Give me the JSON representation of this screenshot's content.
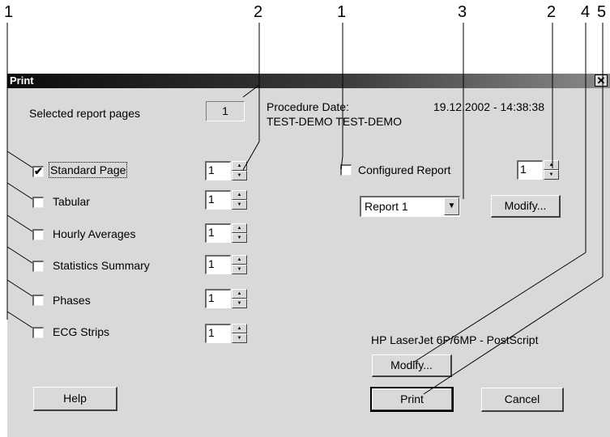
{
  "callouts": [
    "1",
    "2",
    "1",
    "3",
    "2",
    "4",
    "5"
  ],
  "dialog": {
    "title": "Print",
    "close_glyph": "✕",
    "selected_pages_label": "Selected report pages",
    "selected_pages_value": "1",
    "procedure_date_label": "Procedure Date:",
    "procedure_date_value": "19.12.2002 - 14:38:38",
    "patient_name": "TEST-DEMO TEST-DEMO"
  },
  "reports": [
    {
      "label": "Standard Page",
      "checked": true,
      "copies": "1"
    },
    {
      "label": "Tabular",
      "checked": false,
      "copies": "1"
    },
    {
      "label": "Hourly Averages",
      "checked": false,
      "copies": "1"
    },
    {
      "label": "Statistics Summary",
      "checked": false,
      "copies": "1"
    },
    {
      "label": "Phases",
      "checked": false,
      "copies": "1"
    },
    {
      "label": "ECG Strips",
      "checked": false,
      "copies": "1"
    }
  ],
  "configured": {
    "label": "Configured Report",
    "checked": false,
    "copies": "1",
    "selected_report": "Report 1",
    "modify_label": "Modify..."
  },
  "printer": {
    "name": "HP LaserJet 6P/6MP - PostScript",
    "modify_label": "Modify..."
  },
  "buttons": {
    "help": "Help",
    "print": "Print",
    "cancel": "Cancel"
  },
  "icons": {
    "check": "✔",
    "spin_up": "▲",
    "spin_down": "▼",
    "dropdown": "▼"
  }
}
